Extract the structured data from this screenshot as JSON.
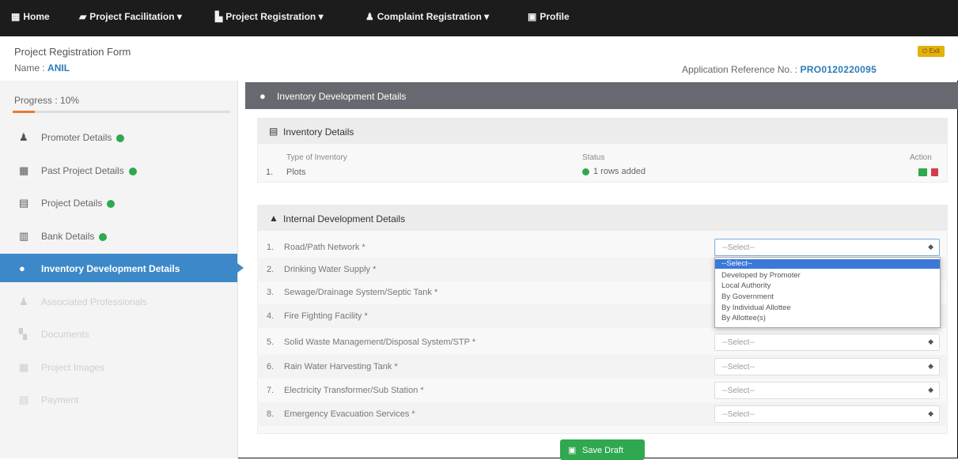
{
  "topnav": {
    "items": [
      {
        "icon": "home-icon",
        "glyph": "▦",
        "label": "Home"
      },
      {
        "icon": "briefcase-icon",
        "glyph": "▰",
        "label": "Project Facilitation ▾"
      },
      {
        "icon": "building-icon",
        "glyph": "▙",
        "label": "Project Registration ▾"
      },
      {
        "icon": "user-icon",
        "glyph": "♟",
        "label": "Complaint Registration ▾"
      },
      {
        "icon": "id-card-icon",
        "glyph": "▣",
        "label": "Profile"
      }
    ]
  },
  "header": {
    "form_title": "Project Registration Form",
    "name_label": "Name :",
    "name_value": "ANIL",
    "exit_label": "Exit",
    "app_ref_label": "Application Reference No. :",
    "app_ref_value": "PRO0120220095"
  },
  "sidebar": {
    "progress_label": "Progress : 10%",
    "progress_fraction": 0.1,
    "items": [
      {
        "icon": "user-icon",
        "glyph": "♟",
        "label": "Promoter Details",
        "done": true
      },
      {
        "icon": "building-icon",
        "glyph": "▦",
        "label": "Past Project Details",
        "done": true
      },
      {
        "icon": "file-icon",
        "glyph": "▤",
        "label": "Project Details",
        "done": true
      },
      {
        "icon": "bank-icon",
        "glyph": "▥",
        "label": "Bank Details",
        "done": true
      },
      {
        "icon": "cloud-icon",
        "glyph": "●",
        "label": "Inventory Development Details",
        "active": true
      },
      {
        "icon": "users-icon",
        "glyph": "♟",
        "label": "Associated Professionals",
        "disabled": true
      },
      {
        "icon": "documents-icon",
        "glyph": "▚",
        "label": "Documents",
        "disabled": true
      },
      {
        "icon": "picture-icon",
        "glyph": "▩",
        "label": "Project Images",
        "disabled": true
      },
      {
        "icon": "payment-icon",
        "glyph": "▤",
        "label": "Payment",
        "disabled": true
      }
    ]
  },
  "main": {
    "section_title": "Inventory Development Details",
    "inventory": {
      "title": "Inventory Details",
      "col_type": "Type of Inventory",
      "col_status": "Status",
      "col_action": "Action",
      "rows": [
        {
          "no": "1.",
          "type": "Plots",
          "status": "1 rows added"
        }
      ]
    },
    "development": {
      "title": "Internal Development Details",
      "rows": [
        {
          "no": "1.",
          "label": "Road/Path Network *",
          "value": "--Select--"
        },
        {
          "no": "2.",
          "label": "Drinking Water Supply *",
          "value": "--Select--"
        },
        {
          "no": "3.",
          "label": "Sewage/Drainage System/Septic Tank *",
          "value": "--Select--"
        },
        {
          "no": "4.",
          "label": "Fire Fighting Facility *",
          "value": "--Select--"
        },
        {
          "no": "5.",
          "label": "Solid Waste Management/Disposal System/STP *",
          "value": "--Select--"
        },
        {
          "no": "6.",
          "label": "Rain Water Harvesting Tank *",
          "value": "--Select--"
        },
        {
          "no": "7.",
          "label": "Electricity Transformer/Sub Station *",
          "value": "--Select--"
        },
        {
          "no": "8.",
          "label": "Emergency Evacuation Services *",
          "value": "--Select--"
        }
      ],
      "dropdown_options": [
        "--Select--",
        "Developed by Promoter",
        "Local Authority",
        "By Government",
        "By Individual Allottee",
        "By Allottee(s)"
      ]
    },
    "save_label": "Save Draft"
  }
}
